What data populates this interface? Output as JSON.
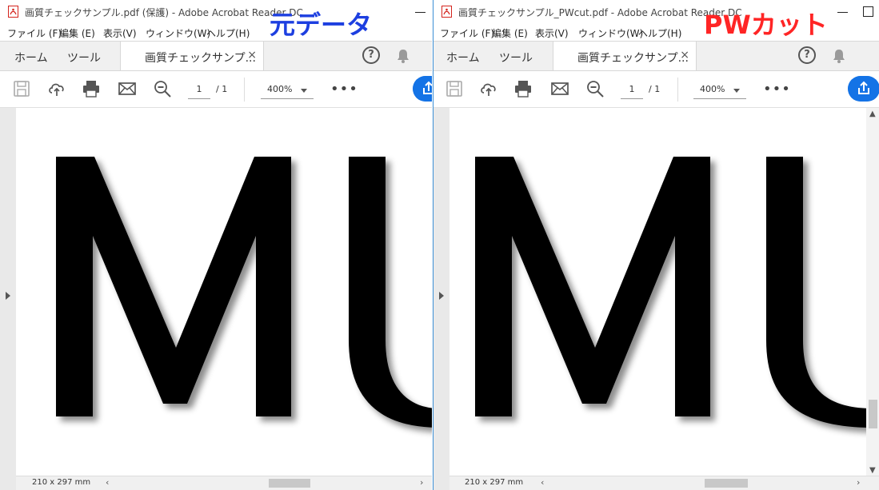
{
  "left_window": {
    "title": "画質チェックサンプル.pdf (保護) - Adobe Acrobat Reader DC",
    "menu": [
      "ファイル (F)",
      "編集 (E)",
      "表示(V)",
      "ウィンドウ(W)",
      "ヘルプ(H)"
    ],
    "tabs": {
      "home": "ホーム",
      "tools": "ツール",
      "document": "画質チェックサンプ...",
      "close": "×"
    },
    "page_current": "1",
    "page_total": "/ 1",
    "zoom": "400%",
    "page_size": "210 x 297 mm",
    "annotation": "元データ"
  },
  "right_window": {
    "title": "画質チェックサンプル_PWcut.pdf - Adobe Acrobat Reader DC",
    "menu": [
      "ファイル (F)",
      "編集 (E)",
      "表示(V)",
      "ウィンドウ(W)",
      "ヘルプ(H)"
    ],
    "tabs": {
      "home": "ホーム",
      "tools": "ツール",
      "document": "画質チェックサンプ...",
      "close": "×"
    },
    "page_current": "1",
    "page_total": "/ 1",
    "zoom": "400%",
    "page_size": "210 x 297 mm",
    "annotation": "PWカット"
  },
  "document_text": "MU",
  "icons": [
    "pdf-icon",
    "help-icon",
    "bell-icon",
    "save-icon",
    "upload-icon",
    "print-icon",
    "mail-icon",
    "zoom-out-icon",
    "more-icon",
    "share-icon"
  ],
  "colors": {
    "accent": "#1473e6",
    "annotation_left": "#1d3fe0",
    "annotation_right": "#ff2525",
    "pdf_red": "#d4231c"
  }
}
